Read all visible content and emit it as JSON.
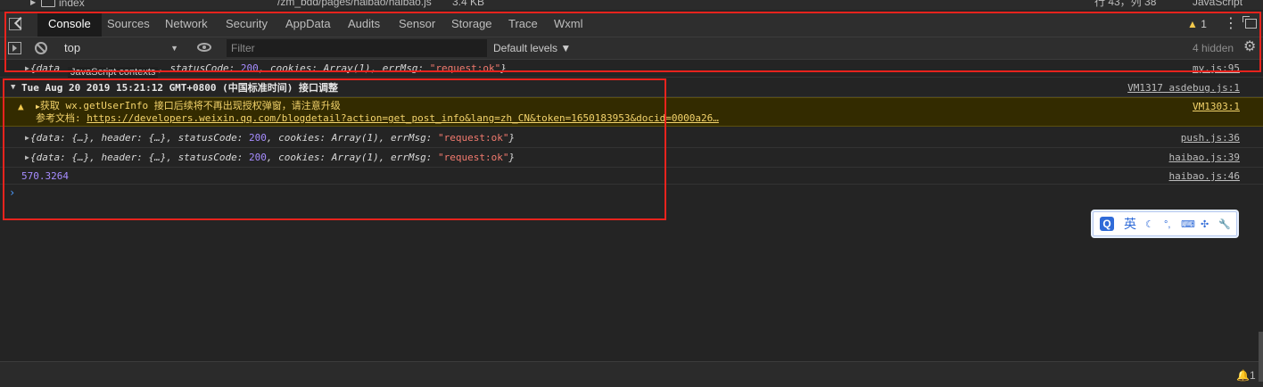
{
  "filestrip": {
    "folder_name": "index",
    "path": "/zm_bdd/pages/haibao/haibao.js",
    "size": "3.4 KB",
    "cursor_pos": "行 43，列 38",
    "language": "JavaScript"
  },
  "tabs": [
    {
      "label": "Console",
      "active": true
    },
    {
      "label": "Sources"
    },
    {
      "label": "Network"
    },
    {
      "label": "Security"
    },
    {
      "label": "AppData"
    },
    {
      "label": "Audits"
    },
    {
      "label": "Sensor"
    },
    {
      "label": "Storage"
    },
    {
      "label": "Trace"
    },
    {
      "label": "Wxml"
    }
  ],
  "toolbar": {
    "warn_count": "1",
    "more_glyph": "⋮"
  },
  "filter": {
    "context": "top",
    "placeholder": "Filter",
    "levels": "Default levels ▼",
    "hidden": "4 hidden",
    "tooltip": "JavaScript contexts"
  },
  "log": {
    "first_row": {
      "prefix": "{data",
      "rest": ", statusCode: ",
      "status": "200",
      "cookies_label": ", cookies: ",
      "cookies": "Array(1)",
      "err_label": ", errMsg: ",
      "err": "\"request:ok\"",
      "close": "}",
      "source": "my.js:95"
    },
    "group": {
      "title": "Tue Aug 20 2019 15:21:12 GMT+0800 (中国标准时间) 接口调整",
      "source": "VM1317 asdebug.js:1"
    },
    "warning": {
      "line1_prefix": "获取 ",
      "line1_api": "wx.getUserInfo",
      "line1_rest": " 接口后续将不再出现授权弹窗，请注意升级",
      "line2_label": "参考文档: ",
      "line2_link": "https://developers.weixin.qq.com/blogdetail?action=get_post_info&lang=zh_CN&token=1650183953&docid=0000a26…",
      "source": "VM1303:1"
    },
    "rows": [
      {
        "open": "{data: {…}, header: {…}, statusCode: ",
        "status": "200",
        "cookies_label": ", cookies: ",
        "cookies": "Array(1)",
        "err_label": ", errMsg: ",
        "err": "\"request:ok\"",
        "close": "}",
        "source": "push.js:36"
      },
      {
        "open": "{data: {…}, header: {…}, statusCode: ",
        "status": "200",
        "cookies_label": ", cookies: ",
        "cookies": "Array(1)",
        "err_label": ", errMsg: ",
        "err": "\"request:ok\"",
        "close": "}",
        "source": "haibao.js:39"
      }
    ],
    "number_row": {
      "value": "570.3264",
      "source": "haibao.js:46"
    },
    "prompt": "›"
  },
  "ime": {
    "logo": "Q",
    "lang": "英",
    "moon": "☾",
    "punct": "°,",
    "keyboard": "⌨",
    "split": "✣",
    "tool": "🔧"
  },
  "bottom": {
    "bell": "🔔1"
  },
  "colors": {
    "accent_red": "#e8231d",
    "warning_text": "#f3d36b",
    "number": "#a68cff",
    "string": "#f27a6e",
    "ime_blue": "#2f6bd8"
  }
}
